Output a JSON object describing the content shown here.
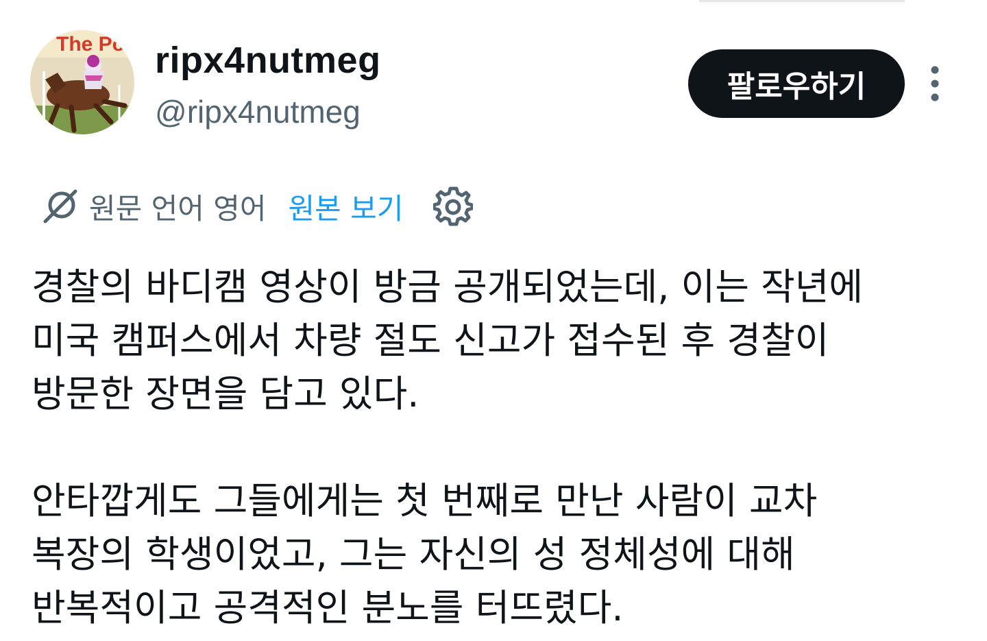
{
  "account": {
    "display_name": "ripx4nutmeg",
    "handle": "@ripx4nutmeg",
    "avatar_icon": "horse-racing-avatar-icon",
    "avatar_text": "The Post"
  },
  "actions": {
    "follow_label": "팔로우하기",
    "more_icon": "more-vertical-icon"
  },
  "translation": {
    "icon": "translate-icon",
    "source_language_label": "원문 언어 영어",
    "show_original_label": "원본 보기",
    "settings_icon": "gear-icon",
    "link_color": "#1d9bf0"
  },
  "tweet": {
    "paragraphs": [
      {
        "lines": [
          "경찰의 바디캠 영상이 방금 공개되었는데, 이는 작년에",
          "미국 캠퍼스에서 차량 절도 신고가 접수된 후 경찰이",
          "방문한 장면을 담고 있다."
        ]
      },
      {
        "lines": [
          "안타깝게도 그들에게는 첫 번째로 만난 사람이 교차",
          "복장의 학생이었고, 그는 자신의 성 정체성에 대해",
          "반복적이고 공격적인 분노를 터뜨렸다."
        ]
      }
    ]
  },
  "colors": {
    "text_primary": "#0f1419",
    "text_secondary": "#536471",
    "button_bg": "#0f1419",
    "button_text": "#ffffff"
  }
}
